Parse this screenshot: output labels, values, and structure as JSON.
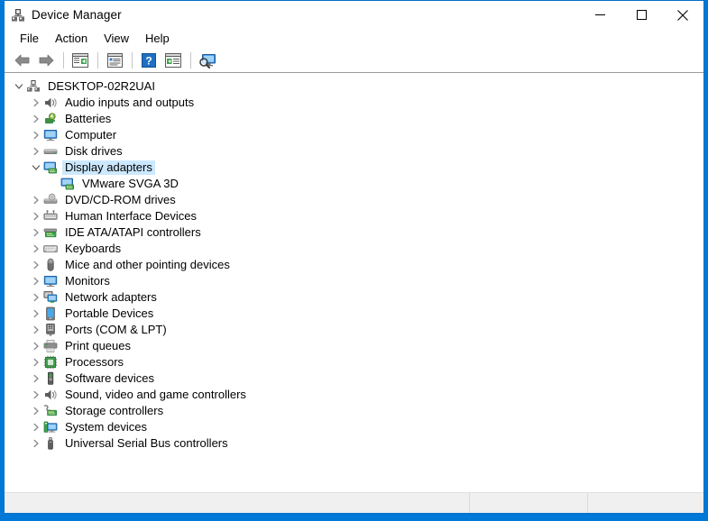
{
  "window": {
    "title": "Device Manager",
    "title_icon": "device-manager-icon",
    "controls": {
      "minimize": "Minimize",
      "maximize": "Maximize",
      "close": "Close"
    }
  },
  "menubar": {
    "items": [
      {
        "label": "File"
      },
      {
        "label": "Action"
      },
      {
        "label": "View"
      },
      {
        "label": "Help"
      }
    ]
  },
  "toolbar": {
    "buttons": [
      {
        "name": "back-arrow-icon",
        "tooltip": "Back"
      },
      {
        "name": "forward-arrow-icon",
        "tooltip": "Forward"
      },
      {
        "name": "show-hide-console-tree-icon",
        "tooltip": "Show/Hide Console Tree"
      },
      {
        "name": "properties-icon",
        "tooltip": "Properties"
      },
      {
        "name": "help-icon",
        "tooltip": "Help"
      },
      {
        "name": "update-driver-icon",
        "tooltip": "Update driver"
      },
      {
        "name": "scan-hardware-changes-icon",
        "tooltip": "Scan for hardware changes"
      }
    ]
  },
  "tree": {
    "root": {
      "label": "DESKTOP-02R2UAI",
      "icon": "computer-root-icon",
      "expanded": true,
      "selected": false
    },
    "nodes": [
      {
        "label": "Audio inputs and outputs",
        "icon": "speaker-icon",
        "expanded": false,
        "selected": false,
        "depth": 1
      },
      {
        "label": "Batteries",
        "icon": "battery-icon",
        "expanded": false,
        "selected": false,
        "depth": 1
      },
      {
        "label": "Computer",
        "icon": "monitor-icon",
        "expanded": false,
        "selected": false,
        "depth": 1
      },
      {
        "label": "Disk drives",
        "icon": "disk-drive-icon",
        "expanded": false,
        "selected": false,
        "depth": 1
      },
      {
        "label": "Display adapters",
        "icon": "display-adapter-icon",
        "expanded": true,
        "selected": true,
        "depth": 1
      },
      {
        "label": "VMware SVGA 3D",
        "icon": "display-adapter-icon",
        "expanded": null,
        "selected": false,
        "depth": 2
      },
      {
        "label": "DVD/CD-ROM drives",
        "icon": "optical-drive-icon",
        "expanded": false,
        "selected": false,
        "depth": 1
      },
      {
        "label": "Human Interface Devices",
        "icon": "hid-icon",
        "expanded": false,
        "selected": false,
        "depth": 1
      },
      {
        "label": "IDE ATA/ATAPI controllers",
        "icon": "ide-controller-icon",
        "expanded": false,
        "selected": false,
        "depth": 1
      },
      {
        "label": "Keyboards",
        "icon": "keyboard-icon",
        "expanded": false,
        "selected": false,
        "depth": 1
      },
      {
        "label": "Mice and other pointing devices",
        "icon": "mouse-icon",
        "expanded": false,
        "selected": false,
        "depth": 1
      },
      {
        "label": "Monitors",
        "icon": "monitor-icon",
        "expanded": false,
        "selected": false,
        "depth": 1
      },
      {
        "label": "Network adapters",
        "icon": "network-adapter-icon",
        "expanded": false,
        "selected": false,
        "depth": 1
      },
      {
        "label": "Portable Devices",
        "icon": "portable-device-icon",
        "expanded": false,
        "selected": false,
        "depth": 1
      },
      {
        "label": "Ports (COM & LPT)",
        "icon": "port-icon",
        "expanded": false,
        "selected": false,
        "depth": 1
      },
      {
        "label": "Print queues",
        "icon": "printer-icon",
        "expanded": false,
        "selected": false,
        "depth": 1
      },
      {
        "label": "Processors",
        "icon": "processor-icon",
        "expanded": false,
        "selected": false,
        "depth": 1
      },
      {
        "label": "Software devices",
        "icon": "software-device-icon",
        "expanded": false,
        "selected": false,
        "depth": 1
      },
      {
        "label": "Sound, video and game controllers",
        "icon": "speaker-icon",
        "expanded": false,
        "selected": false,
        "depth": 1
      },
      {
        "label": "Storage controllers",
        "icon": "storage-controller-icon",
        "expanded": false,
        "selected": false,
        "depth": 1
      },
      {
        "label": "System devices",
        "icon": "system-device-icon",
        "expanded": false,
        "selected": false,
        "depth": 1
      },
      {
        "label": "Universal Serial Bus controllers",
        "icon": "usb-icon",
        "expanded": false,
        "selected": false,
        "depth": 1
      }
    ]
  },
  "statusbar": {
    "main": "",
    "mid": "",
    "end": ""
  },
  "colors": {
    "window_border": "#0070c8",
    "desktop": "#0078d7",
    "selection": "#cce8ff",
    "toolbar_divider": "#9b9b9b",
    "statusbar_bg": "#f0f0f0"
  }
}
